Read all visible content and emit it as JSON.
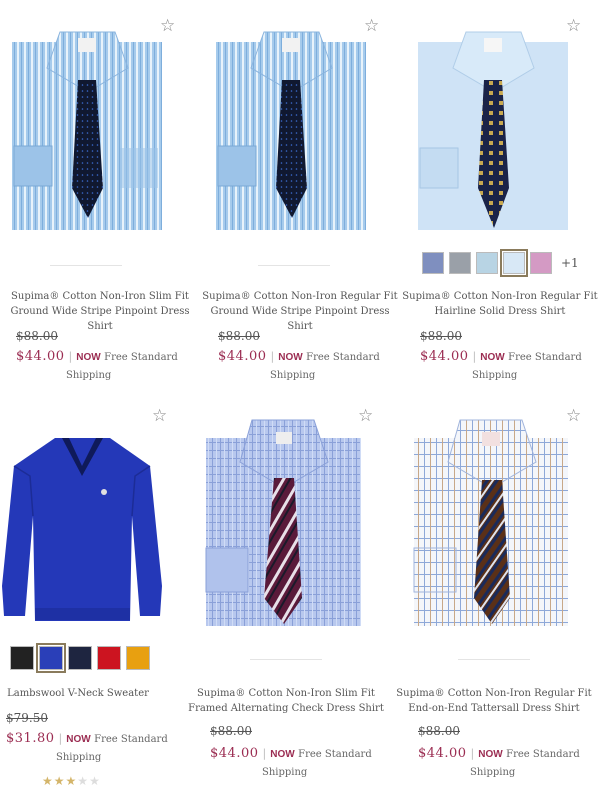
{
  "products": [
    {
      "name_line1": "Supima® Cotton Non-Iron Slim Fit",
      "name_line2": "Ground Wide Stripe Pinpoint Dress Shirt",
      "was_price": "$88.00",
      "price": "$44.00",
      "now_label": "NOW",
      "ship_line1": "Free Standard",
      "ship_line2": "Shipping"
    },
    {
      "name_line1": "Supima® Cotton Non-Iron Regular Fit",
      "name_line2": "Ground Wide Stripe Pinpoint Dress Shirt",
      "was_price": "$88.00",
      "price": "$44.00",
      "now_label": "NOW",
      "ship_line1": "Free Standard",
      "ship_line2": "Shipping"
    },
    {
      "name_line1": "Supima® Cotton Non-Iron Regular Fit",
      "name_line2": "Hairline Solid Dress Shirt",
      "was_price": "$88.00",
      "price": "$44.00",
      "now_label": "NOW",
      "ship_line1": "Free Standard",
      "ship_line2": "Shipping",
      "swatch_colors": [
        "#7f8fbf",
        "#9aa0a8",
        "#b8d4e4",
        "#d8e8f6",
        "#d49ac4"
      ],
      "more_colors": "+1"
    },
    {
      "name_line1": "Lambswool V-Neck Sweater",
      "name_line2": "",
      "was_price": "$79.50",
      "price": "$31.80",
      "now_label": "NOW",
      "ship_line1": "Free Standard",
      "ship_line2": "Shipping",
      "swatch_colors": [
        "#222222",
        "#2a3fb8",
        "#1e2540",
        "#cc1420",
        "#e8a010"
      ],
      "rating": 3
    },
    {
      "name_line1": "Supima® Cotton Non-Iron Slim Fit",
      "name_line2": "Framed Alternating Check Dress Shirt",
      "was_price": "$88.00",
      "price": "$44.00",
      "now_label": "NOW",
      "ship_line1": "Free Standard",
      "ship_line2": "Shipping"
    },
    {
      "name_line1": "Supima® Cotton Non-Iron Regular Fit",
      "name_line2": "End-on-End Tattersall Dress Shirt",
      "was_price": "$88.00",
      "price": "$44.00",
      "now_label": "NOW",
      "ship_line1": "Free Standard",
      "ship_line2": "Shipping"
    }
  ]
}
